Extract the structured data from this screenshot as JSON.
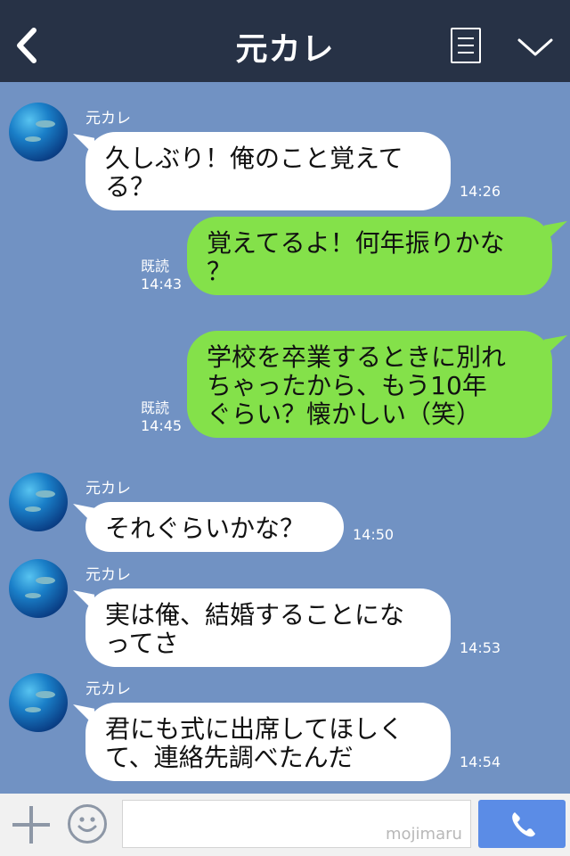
{
  "header": {
    "title": "元カレ"
  },
  "messages": [
    {
      "side": "left",
      "sender": "元カレ",
      "text": "久しぶり！俺のこと覚えて\nる？",
      "time": "14:26"
    },
    {
      "side": "right",
      "read": "既読",
      "text": "覚えてるよ！何年振りかな\n？",
      "time": "14:43"
    },
    {
      "side": "right",
      "read": "既読",
      "text": "学校を卒業するときに別れ\nちゃったから、もう10年\nぐらい？懐かしい（笑）",
      "time": "14:45"
    },
    {
      "side": "left",
      "sender": "元カレ",
      "text": "それぐらいかな？",
      "time": "14:50"
    },
    {
      "side": "left",
      "sender": "元カレ",
      "text": "実は俺、結婚することにな\nってさ",
      "time": "14:53"
    },
    {
      "side": "left",
      "sender": "元カレ",
      "text": "君にも式に出席してほしく\nて、連絡先調べたんだ",
      "time": "14:54"
    }
  ],
  "watermark": "mojimaru",
  "icons": {
    "back": "chevron-left-icon",
    "menu": "notes-icon",
    "collapse": "chevron-down-icon",
    "plus": "plus-icon",
    "emoji": "smiley-icon",
    "call": "phone-icon"
  },
  "colors": {
    "header_bg": "#273246",
    "chat_bg": "#7192c3",
    "left_bubble": "#ffffff",
    "right_bubble": "#84e14a",
    "call_button": "#5b8ce6"
  }
}
